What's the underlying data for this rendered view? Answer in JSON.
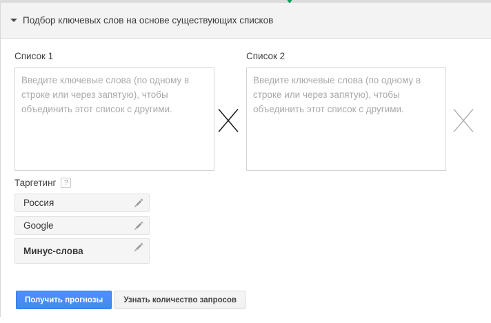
{
  "panel": {
    "title": "Подбор ключевых слов на основе существующих списков",
    "collapse_icon": "triangle-down-icon",
    "top_indicator_icon": "green-caret-icon",
    "top_indicator_color": "#0f9d58"
  },
  "lists": {
    "list1_label": "Список 1",
    "list2_label": "Список 2",
    "placeholder": "Введите ключевые слова (по одному в строке или через запятую), чтобы объединить этот список с другими.",
    "combine_icon": "multiply-x-icon",
    "combine_icon_colors": {
      "active": "#1a1a1a",
      "inactive": "#b4b4b4"
    }
  },
  "targeting": {
    "label": "Таргетинг",
    "help_label": "?",
    "help_icon": "help-question-icon",
    "edit_icon": "pencil-icon",
    "rows": [
      {
        "label": "Россия"
      },
      {
        "label": "Google"
      },
      {
        "label": "Минус-слова"
      }
    ]
  },
  "actions": {
    "primary_label": "Получить прогнозы",
    "secondary_label": "Узнать количество запросов",
    "primary_color": "#4787ed",
    "primary_border_color": "#3079ed"
  }
}
